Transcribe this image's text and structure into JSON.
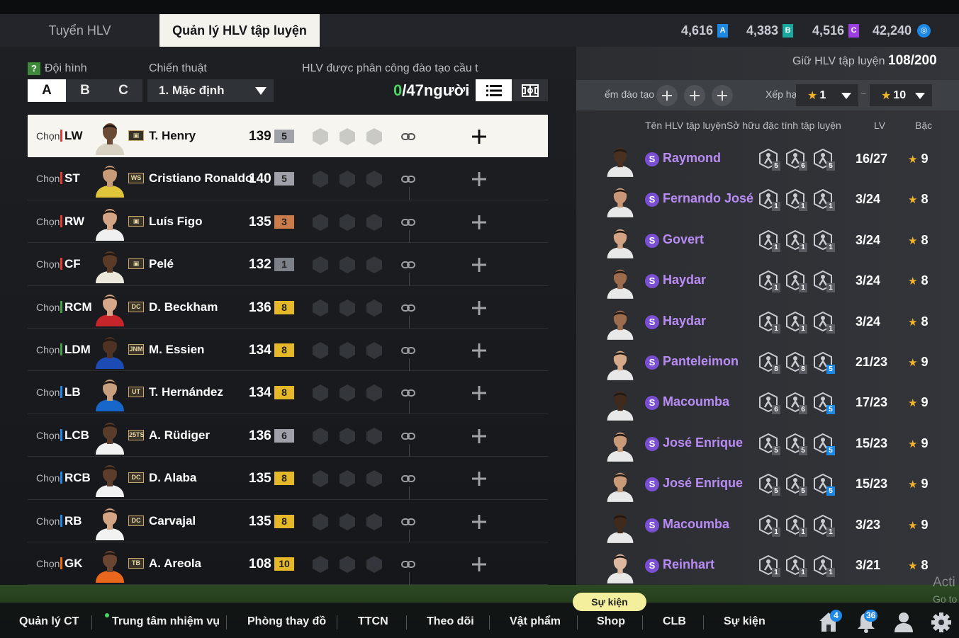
{
  "tabs": [
    {
      "label": "Tuyển HLV"
    },
    {
      "label": "Quản lý HLV tập luyện"
    }
  ],
  "currencies": [
    {
      "value": "4,616",
      "icon": "A",
      "color": "#1e88e5"
    },
    {
      "value": "4,383",
      "icon": "B",
      "color": "#19a9a0"
    },
    {
      "value": "4,516",
      "icon": "C",
      "color": "#9b3fe0"
    },
    {
      "value": "42,240",
      "icon": "coin",
      "color": "#1e88e5"
    }
  ],
  "left": {
    "formation_label": "Đội hình",
    "help_icon": "?",
    "formation_options": [
      "A",
      "B",
      "C"
    ],
    "formation_selected": "A",
    "tactic_label": "Chiến thuật",
    "tactic_value": "1. Mặc định",
    "assigned_label": "HLV được phân công đào tạo cầu t",
    "assigned_count": "0",
    "assigned_total": "/47người"
  },
  "choose_label": "Chọn",
  "players": [
    {
      "pos": "LW",
      "pos_color": "#e53935",
      "season": "▣",
      "name": "T. Henry",
      "ovr": "139",
      "lvl": "5",
      "lvl_color": "#9ea2a8",
      "selected": true,
      "face": "#6b4a35",
      "shirt": "#d8d2c2"
    },
    {
      "pos": "ST",
      "pos_color": "#e53935",
      "season": "WS",
      "name": "Cristiano Ronaldo",
      "ovr": "140",
      "lvl": "5",
      "lvl_color": "#9ea2a8",
      "selected": false,
      "face": "#c79a78",
      "shirt": "#e0c43a"
    },
    {
      "pos": "RW",
      "pos_color": "#e53935",
      "season": "▣",
      "name": "Luís Figo",
      "ovr": "135",
      "lvl": "3",
      "lvl_color": "#c97b4a",
      "selected": false,
      "face": "#d3a585",
      "shirt": "#f0f0f0"
    },
    {
      "pos": "CF",
      "pos_color": "#e53935",
      "season": "▣",
      "name": "Pelé",
      "ovr": "132",
      "lvl": "1",
      "lvl_color": "#7c8087",
      "selected": false,
      "face": "#5b3b28",
      "shirt": "#ece8dc"
    },
    {
      "pos": "RCM",
      "pos_color": "#43a047",
      "season": "DC",
      "name": "D. Beckham",
      "ovr": "136",
      "lvl": "8",
      "lvl_color": "#e5b82a",
      "selected": false,
      "face": "#d7a888",
      "shirt": "#c6262b"
    },
    {
      "pos": "LDM",
      "pos_color": "#43a047",
      "season": "JNM",
      "name": "M. Essien",
      "ovr": "134",
      "lvl": "8",
      "lvl_color": "#e5b82a",
      "selected": false,
      "face": "#4e3325",
      "shirt": "#1c4bb4"
    },
    {
      "pos": "LB",
      "pos_color": "#1e88e5",
      "season": "UT",
      "name": "T. Hernández",
      "ovr": "134",
      "lvl": "8",
      "lvl_color": "#e5b82a",
      "selected": false,
      "face": "#c9a07e",
      "shirt": "#1766c9"
    },
    {
      "pos": "LCB",
      "pos_color": "#1e88e5",
      "season": "25TS",
      "name": "A. Rüdiger",
      "ovr": "136",
      "lvl": "6",
      "lvl_color": "#9ea2a8",
      "selected": false,
      "face": "#5a3c2a",
      "shirt": "#f2f2f2"
    },
    {
      "pos": "RCB",
      "pos_color": "#1e88e5",
      "season": "DC",
      "name": "D. Alaba",
      "ovr": "135",
      "lvl": "8",
      "lvl_color": "#e5b82a",
      "selected": false,
      "face": "#5c3d2b",
      "shirt": "#f2f2f2"
    },
    {
      "pos": "RB",
      "pos_color": "#1e88e5",
      "season": "DC",
      "name": "Carvajal",
      "ovr": "135",
      "lvl": "8",
      "lvl_color": "#e5b82a",
      "selected": false,
      "face": "#d3a585",
      "shirt": "#f2f2f2"
    },
    {
      "pos": "GK",
      "pos_color": "#ef6c00",
      "season": "TB",
      "name": "A. Areola",
      "ovr": "108",
      "lvl": "10",
      "lvl_color": "#e5b82a",
      "selected": false,
      "face": "#6a4632",
      "shirt": "#e8671c"
    }
  ],
  "right": {
    "keep_label": "Giữ HLV tập luyện",
    "keep_value": "108/200",
    "filter_label": "ểm đào tạo",
    "sort_label": "Xếp hạ",
    "star_min": "1",
    "star_max": "10",
    "star_sep": "~",
    "headers": {
      "name": "Tên HLV tập luyện",
      "traits": "Sở hữu đặc tính tập luyện",
      "lv": "LV",
      "bac": "Bậc"
    }
  },
  "coaches": [
    {
      "name": "Raymond",
      "traits": [
        "5",
        "6",
        "5"
      ],
      "trait_blue": [
        false,
        false,
        false
      ],
      "lv": "16/27",
      "bac": "9",
      "face": "#4a3020"
    },
    {
      "name": "Fernando José",
      "traits": [
        "1",
        "1",
        "1"
      ],
      "trait_blue": [
        false,
        false,
        false
      ],
      "lv": "3/24",
      "bac": "8",
      "face": "#c99676"
    },
    {
      "name": "Govert",
      "traits": [
        "1",
        "1",
        "1"
      ],
      "trait_blue": [
        false,
        false,
        false
      ],
      "lv": "3/24",
      "bac": "8",
      "face": "#d2a282"
    },
    {
      "name": "Haydar",
      "traits": [
        "1",
        "1",
        "1"
      ],
      "trait_blue": [
        false,
        false,
        false
      ],
      "lv": "3/24",
      "bac": "8",
      "face": "#9c6c4c"
    },
    {
      "name": "Haydar",
      "traits": [
        "1",
        "1",
        "1"
      ],
      "trait_blue": [
        false,
        false,
        false
      ],
      "lv": "3/24",
      "bac": "8",
      "face": "#9c6c4c"
    },
    {
      "name": "Panteleimon",
      "traits": [
        "8",
        "8",
        "5"
      ],
      "trait_blue": [
        false,
        false,
        true
      ],
      "lv": "21/23",
      "bac": "9",
      "face": "#d6aa88"
    },
    {
      "name": "Macoumba",
      "traits": [
        "6",
        "6",
        "5"
      ],
      "trait_blue": [
        false,
        false,
        true
      ],
      "lv": "17/23",
      "bac": "9",
      "face": "#3f2a1c"
    },
    {
      "name": "José Enrique",
      "traits": [
        "5",
        "5",
        "5"
      ],
      "trait_blue": [
        false,
        false,
        true
      ],
      "lv": "15/23",
      "bac": "9",
      "face": "#c99a78"
    },
    {
      "name": "José Enrique",
      "traits": [
        "5",
        "5",
        "5"
      ],
      "trait_blue": [
        false,
        false,
        true
      ],
      "lv": "15/23",
      "bac": "9",
      "face": "#c99a78"
    },
    {
      "name": "Macoumba",
      "traits": [
        "1",
        "1",
        "1"
      ],
      "trait_blue": [
        false,
        false,
        false
      ],
      "lv": "3/23",
      "bac": "9",
      "face": "#3f2a1c"
    },
    {
      "name": "Reinhart",
      "traits": [
        "1",
        "1",
        "1"
      ],
      "trait_blue": [
        false,
        false,
        false
      ],
      "lv": "3/21",
      "bac": "8",
      "face": "#dcb8a0"
    }
  ],
  "coach_s": "S",
  "nav": [
    "Quản lý CT",
    "Trung tâm nhiệm vụ",
    "Phòng thay đồ",
    "TTCN",
    "Theo dõi",
    "Vật phẩm",
    "Shop",
    "CLB",
    "Sự kiện"
  ],
  "event_pill": "Sự kiện",
  "badges": {
    "home": "4",
    "bell": "36"
  },
  "watermark": {
    "line1": "Acti",
    "line2": "Go to"
  }
}
